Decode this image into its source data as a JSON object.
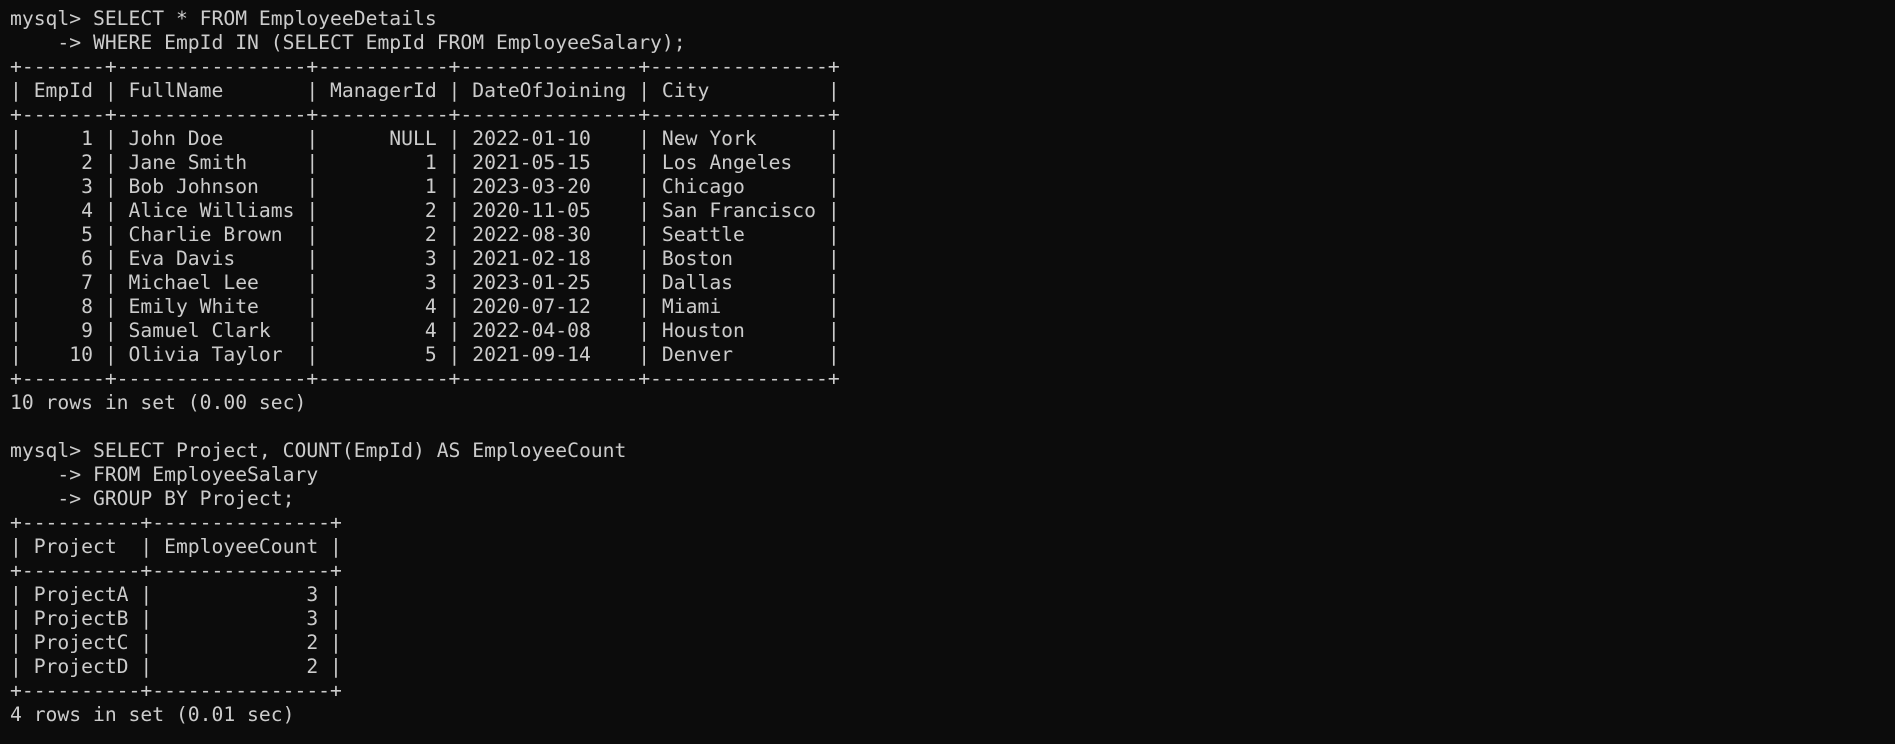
{
  "terminal": {
    "lines": [
      "mysql> SELECT * FROM EmployeeDetails",
      "    -> WHERE EmpId IN (SELECT EmpId FROM EmployeeSalary);",
      "+-------+----------------+-----------+---------------+---------------+",
      "| EmpId | FullName       | ManagerId | DateOfJoining | City          |",
      "+-------+----------------+-----------+---------------+---------------+",
      "|     1 | John Doe       |      NULL | 2022-01-10    | New York      |",
      "|     2 | Jane Smith     |         1 | 2021-05-15    | Los Angeles   |",
      "|     3 | Bob Johnson    |         1 | 2023-03-20    | Chicago       |",
      "|     4 | Alice Williams |         2 | 2020-11-05    | San Francisco |",
      "|     5 | Charlie Brown  |         2 | 2022-08-30    | Seattle       |",
      "|     6 | Eva Davis      |         3 | 2021-02-18    | Boston        |",
      "|     7 | Michael Lee    |         3 | 2023-01-25    | Dallas        |",
      "|     8 | Emily White    |         4 | 2020-07-12    | Miami         |",
      "|     9 | Samuel Clark   |         4 | 2022-04-08    | Houston       |",
      "|    10 | Olivia Taylor  |         5 | 2021-09-14    | Denver        |",
      "+-------+----------------+-----------+---------------+---------------+",
      "10 rows in set (0.00 sec)",
      "",
      "mysql> SELECT Project, COUNT(EmpId) AS EmployeeCount",
      "    -> FROM EmployeeSalary",
      "    -> GROUP BY Project;",
      "+----------+---------------+",
      "| Project  | EmployeeCount |",
      "+----------+---------------+",
      "| ProjectA |             3 |",
      "| ProjectB |             3 |",
      "| ProjectC |             2 |",
      "| ProjectD |             2 |",
      "+----------+---------------+",
      "4 rows in set (0.01 sec)"
    ]
  },
  "colors": {
    "background": "#0c0c0c",
    "text": "#cccccc"
  }
}
